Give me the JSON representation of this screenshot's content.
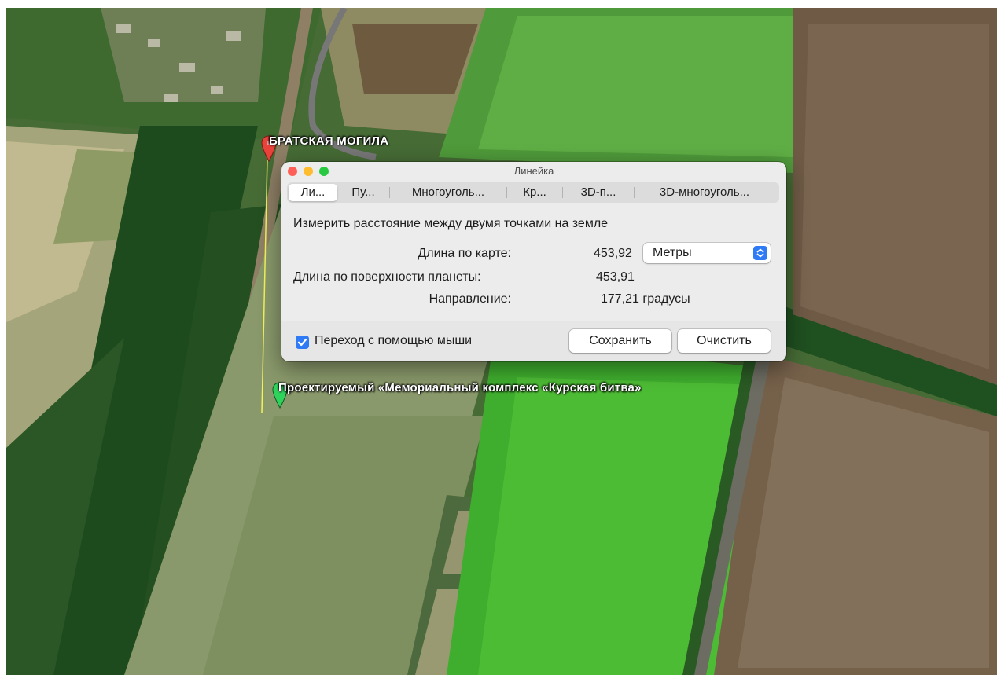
{
  "window": {
    "title": "Линейка",
    "controls": {
      "close_color": "#ff5f57",
      "minimize_color": "#febc2e",
      "zoom_color": "#28c840"
    }
  },
  "tabs": [
    {
      "label": "Ли...",
      "selected": true
    },
    {
      "label": "Пу...",
      "selected": false
    },
    {
      "label": "Многоуголь...",
      "selected": false
    },
    {
      "label": "Кр...",
      "selected": false
    },
    {
      "label": "3D-п...",
      "selected": false
    },
    {
      "label": "3D-многоуголь...",
      "selected": false
    }
  ],
  "description": "Измерить расстояние между двумя точками на земле",
  "measurements": {
    "map_length_label": "Длина по карте:",
    "map_length_value": "453,92",
    "surface_length_label": "Длина по поверхности планеты:",
    "surface_length_value": "453,91",
    "heading_label": "Направление:",
    "heading_value": "177,21 градусы"
  },
  "units_select": {
    "value": "Метры",
    "icon": "chevron-up-down-icon"
  },
  "footer": {
    "mouse_navigation_label": "Переход с помощью мыши",
    "mouse_navigation_checked": true,
    "save_label": "Сохранить",
    "clear_label": "Очистить"
  },
  "map": {
    "placemarks": [
      {
        "label": "БРАТСКАЯ МОГИЛА",
        "color": "#e8423a",
        "icon": "map-pin-icon"
      },
      {
        "label": "Проектируемый «Мемориальный комплекс «Курская битва»",
        "color": "#2ed35b",
        "icon": "map-pin-icon"
      }
    ],
    "ruler_line_color": "#f2f25a"
  },
  "accent_color": "#2f7bf5"
}
